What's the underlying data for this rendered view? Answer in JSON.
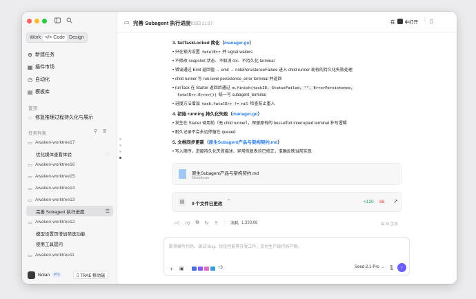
{
  "sidebar": {
    "tabs": [
      "Work",
      "Code",
      "Design"
    ],
    "nav": [
      {
        "label": "新建任务",
        "icon": "new-task-icon"
      },
      {
        "label": "插件市场",
        "icon": "plugin-icon"
      },
      {
        "label": "自动化",
        "icon": "automation-icon"
      },
      {
        "label": "模板库",
        "icon": "template-icon"
      }
    ],
    "pinned_label": "置顶",
    "pinned_item": "修复推理过程持久化与展示",
    "task_list_label": "任务列表",
    "worktrees": [
      {
        "type": "folder",
        "label": "Awaken-worktree17"
      },
      {
        "type": "task",
        "label": "优化媒体查看体验",
        "spinner": true
      },
      {
        "type": "folder",
        "label": "Awaken-worktree16"
      },
      {
        "type": "folder",
        "label": "Awaken-worktree15"
      },
      {
        "type": "folder",
        "label": "Awaken-worktree14"
      },
      {
        "type": "folder",
        "label": "Awaken-worktree13"
      },
      {
        "type": "task",
        "label": "完善 Subagent 执行进度",
        "selected": true
      },
      {
        "type": "folder",
        "label": "Awaken-worktree12"
      },
      {
        "type": "task",
        "label": "模型设置页增加筛选功能"
      },
      {
        "type": "task",
        "label": "使用工具提问"
      },
      {
        "type": "folder",
        "label": "Awaken-worktree11"
      }
    ],
    "user": {
      "name": "Nolan",
      "badge": "Pro"
    },
    "mobile_button": "TRAE 移动端"
  },
  "header": {
    "title": "完善 Subagent 执行进度",
    "timestamp": "08月02日 21:37",
    "open_in_prefix": "在",
    "open_in_app": "中打开"
  },
  "content": {
    "s3_title": "3. failTaskLocked 简化（",
    "s3_file": "manager.go",
    "s3_close": "）",
    "s3_b1_pre": "只在锁内设置 ",
    "s3_b1_code": "fatalErr",
    "s3_b1_post": " 并 signal waiters",
    "s3_b2": "不修改 snapshot 状态、不取消 ctx、不持久化 terminal",
    "s3_b3": "错误通过 Emit 返回值 → emit → notePersistenceFailure 进入 child runner 现有的持久化失败处理",
    "s3_b4": "child runner 写 run-level persistence_error terminal 并返回",
    "s3_b5_pre": "runTask 在 Starter 返回后通过 ",
    "s3_b5_code": "m.finish(taskID, StatusFailed, \"\", ErrorPersistence,",
    "s3_b5_code2": "fatalErr.Error())",
    "s3_b5_post": " 统一写 subagent_terminal",
    "s3_b6_pre": "进度方法增加 ",
    "s3_b6_code": "task.fatalErr != nil",
    "s3_b6_post": " 检查防止重入",
    "s4_title": "4. 初始 running 持久化失败（",
    "s4_file": "manager.go",
    "s4_close": "）",
    "s4_b1": "发生在 Starter 调用前（无 child runner），保留原有的 best-effort interrupted terminal 补写逻辑",
    "s4_b2": "耐久记录不会永远停留在 queued",
    "s5_title": "5. 文档同步更新（",
    "s5_file": "原生Subagent产品与架构契约.md",
    "s5_close": "）",
    "s5_b1": "写入顺序、进度持久化失败描述、异常恢复表均已修正，准确反映当前实现"
  },
  "file_card": {
    "name": "原生Subagent产品与架构契约.md",
    "type": "Markdown"
  },
  "changes": {
    "label": "9 个文件已更改",
    "added": "+120",
    "removed": "-88"
  },
  "actions": {
    "tokens_label": "消耗",
    "tokens": "1,333.68",
    "ai_label": "由 AI 生成"
  },
  "composer": {
    "placeholder": "即将编写代码、调试 Bug、优化性能等开发工作，交付生产级代码产物。",
    "more_count": "+3",
    "model": "Seed-2.1-Pro"
  },
  "colors": {
    "accent": "#6b5cff",
    "link": "#2b7de9",
    "added": "#1f9d55",
    "removed": "#e04848"
  }
}
